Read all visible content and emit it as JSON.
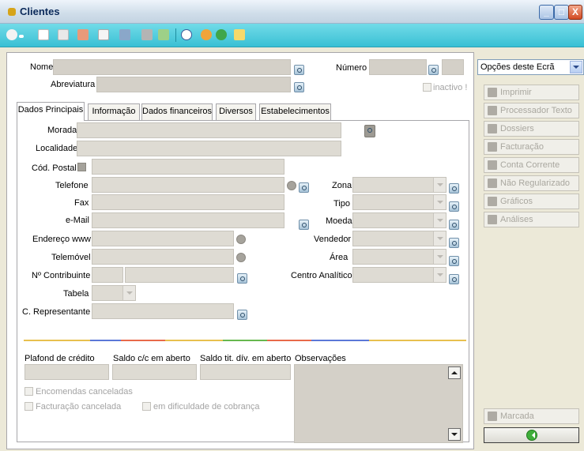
{
  "window": {
    "title": "Clientes",
    "controls": {
      "minimize": "_",
      "maximize": "□",
      "close": "X"
    }
  },
  "toolbar": {
    "icons": [
      "search-dropdown-icon",
      "new-document-icon",
      "copy-document-icon",
      "delete-icon",
      "properties-icon",
      "grid-icon",
      "print-icon",
      "refresh-icon",
      "help-icon",
      "tools-icon",
      "world-icon",
      "attachment-icon"
    ]
  },
  "header": {
    "nome_label": "Nome",
    "numero_label": "Número",
    "abreviatura_label": "Abreviatura",
    "inactivo_label": "inactivo !"
  },
  "tabs": [
    {
      "label": "Dados Principais",
      "active": true
    },
    {
      "label": "Informação",
      "active": false
    },
    {
      "label": "Dados financeiros",
      "active": false
    },
    {
      "label": "Diversos",
      "active": false
    },
    {
      "label": "Estabelecimentos",
      "active": false
    }
  ],
  "fields": {
    "morada": "Morada",
    "localidade": "Localidade",
    "cod_postal": "Cód. Postal",
    "telefone": "Telefone",
    "fax": "Fax",
    "email": "e-Mail",
    "endereco_www": "Endereço www",
    "telemovel": "Telemóvel",
    "contribuinte": "Nº Contribuinte",
    "tabela": "Tabela",
    "representante": "C. Representante",
    "zona": "Zona",
    "tipo": "Tipo",
    "moeda": "Moeda",
    "vendedor": "Vendedor",
    "area": "Área",
    "centro_analitico": "Centro Analítico"
  },
  "financial": {
    "plafond": "Plafond de crédito",
    "saldo_cc": "Saldo c/c em aberto",
    "saldo_tit": "Saldo tit. dív. em aberto",
    "observacoes": "Observações"
  },
  "checkboxes": {
    "encomendas": "Encomendas canceladas",
    "facturacao": "Facturação cancelada",
    "dificuldade": "em dificuldade de cobrança"
  },
  "side": {
    "options_label": "Opções deste Ecrã",
    "buttons": [
      "Imprimir",
      "Processador Texto",
      "Dossiers",
      "Facturação",
      "Conta Corrente",
      "Não Regularizado",
      "Gráficos",
      "Análises"
    ],
    "marcada": "Marcada"
  },
  "colors": {
    "toolbar": "#39c0d4",
    "field": "#d4d0c8",
    "window_bg": "#ece9d8"
  }
}
